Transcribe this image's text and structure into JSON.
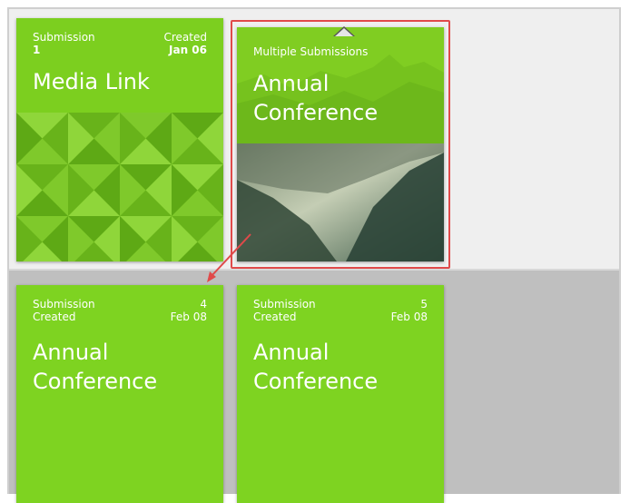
{
  "tiles": {
    "media_link": {
      "submission_label": "Submission",
      "submission_value": "1",
      "created_label": "Created",
      "created_value": "Jan 06",
      "title": "Media Link"
    },
    "selected": {
      "header": "Multiple Submissions",
      "title_line1": "Annual",
      "title_line2": "Conference"
    },
    "submission_4": {
      "submission_label": "Submission",
      "submission_value": "4",
      "created_label": "Created",
      "created_value": "Feb 08",
      "title_line1": "Annual",
      "title_line2": "Conference"
    },
    "submission_5": {
      "submission_label": "Submission",
      "submission_value": "5",
      "created_label": "Created",
      "created_value": "Feb 08",
      "title_line1": "Annual",
      "title_line2": "Conference"
    }
  },
  "colors": {
    "tile_green": "#7ed321",
    "highlight_red": "#e04a4a"
  },
  "icons": {
    "selection_caret": "caret-up-icon",
    "annotation_arrow": "arrow-down-left-icon"
  }
}
